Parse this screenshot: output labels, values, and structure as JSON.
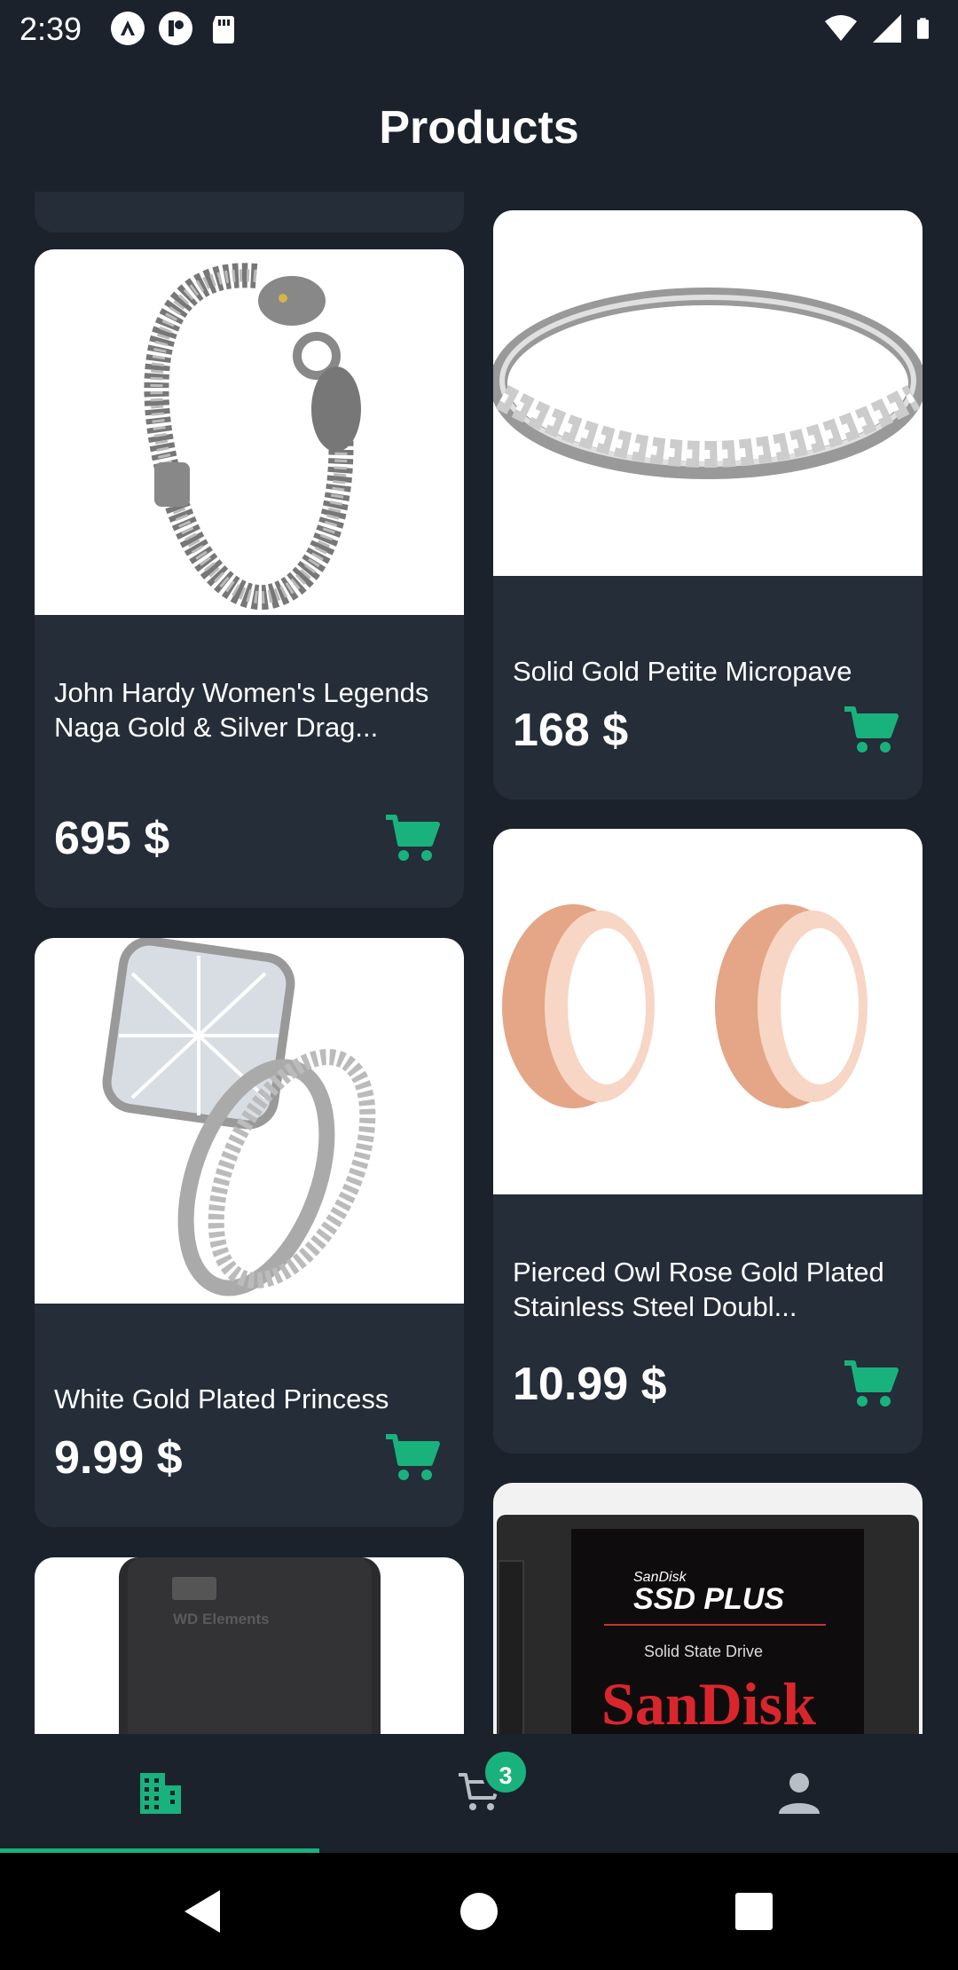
{
  "status_bar": {
    "time": "2:39"
  },
  "header": {
    "title": "Products"
  },
  "products": [
    {
      "name": "John Hardy Women's Legends Naga Gold & Silver Drag...",
      "price": "695 $",
      "image": "bracelet"
    },
    {
      "name": "Solid Gold Petite Micropave",
      "price": "168 $",
      "image": "ring"
    },
    {
      "name": "White Gold Plated Princess",
      "price": "9.99 $",
      "image": "engagement-ring"
    },
    {
      "name": "Pierced Owl Rose Gold Plated Stainless Steel Doubl...",
      "price": "10.99 $",
      "image": "rose-gold-plugs"
    },
    {
      "name": "",
      "price": "",
      "image": "hard-drive",
      "image_text": "WD Elements"
    },
    {
      "name": "",
      "price": "",
      "image": "ssd",
      "image_text": {
        "brand_small": "SanDisk",
        "model": "SSD PLUS",
        "type": "Solid State Drive",
        "brand_large": "SanDisk"
      }
    }
  ],
  "bottom_nav": {
    "items": [
      {
        "name": "products",
        "icon": "building-icon",
        "active": true
      },
      {
        "name": "cart",
        "icon": "cart-icon",
        "badge": "3"
      },
      {
        "name": "profile",
        "icon": "person-icon"
      }
    ]
  },
  "colors": {
    "accent": "#19b27c",
    "background": "#1b222b",
    "card": "#242d38"
  }
}
